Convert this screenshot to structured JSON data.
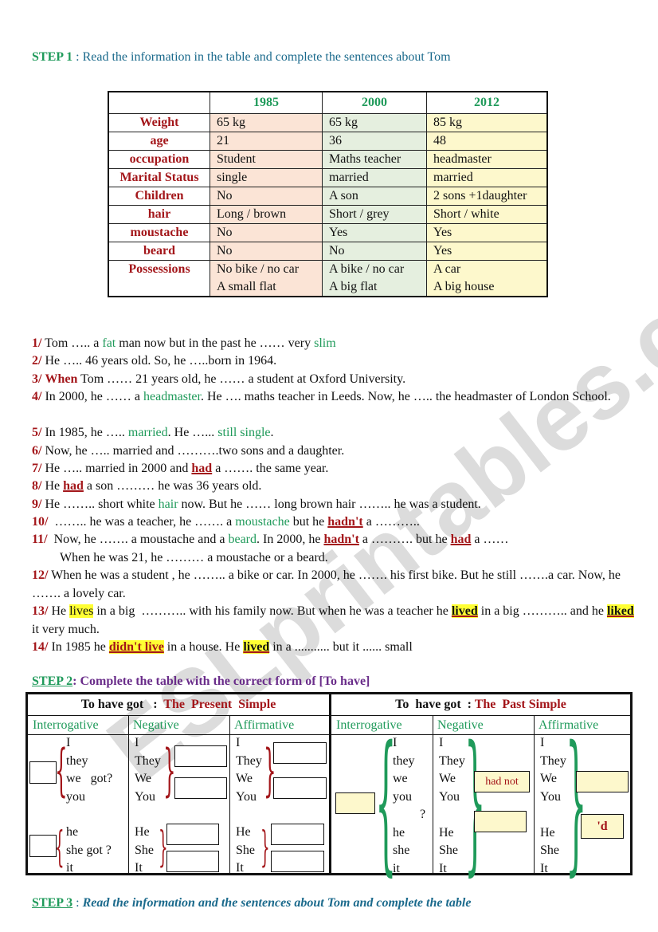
{
  "step1": {
    "label": "STEP 1",
    "separator": " : ",
    "text": "Read the information in the table and complete the sentences about Tom"
  },
  "info_table": {
    "years": [
      "1985",
      "2000",
      "2012"
    ],
    "rows": [
      {
        "label": "Weight",
        "values": [
          "65 kg",
          "65 kg",
          "85 kg"
        ]
      },
      {
        "label": "age",
        "values": [
          "21",
          "36",
          "48"
        ]
      },
      {
        "label": "occupation",
        "values": [
          "Student",
          "Maths teacher",
          "headmaster"
        ]
      },
      {
        "label": "Marital Status",
        "values": [
          "single",
          "married",
          "married"
        ]
      },
      {
        "label": "Children",
        "values": [
          "No",
          "A son",
          "2 sons +1daughter"
        ]
      },
      {
        "label": "hair",
        "values": [
          "Long / brown",
          "Short / grey",
          "Short / white"
        ]
      },
      {
        "label": "moustache",
        "values": [
          "No",
          "Yes",
          "Yes"
        ]
      },
      {
        "label": "beard",
        "values": [
          "No",
          "No",
          "Yes"
        ]
      },
      {
        "label": "Possessions",
        "values": [
          "No bike / no car",
          "A bike / no car",
          "A car"
        ],
        "values2": [
          "A small flat",
          "A big flat",
          "A big house"
        ]
      }
    ]
  },
  "sentences": [
    {
      "num": "1/",
      "parts": [
        {
          "t": " Tom ….. a "
        },
        {
          "t": "fat",
          "c": "g"
        },
        {
          "t": " man now but in the past he …… very "
        },
        {
          "t": "slim",
          "c": "g"
        }
      ]
    },
    {
      "num": "2/",
      "parts": [
        {
          "t": " He ….. 46 years old. So, he …..born in 1964."
        }
      ]
    },
    {
      "num": "3/",
      "parts": [
        {
          "t": " "
        },
        {
          "t": "When",
          "c": "r"
        },
        {
          "t": " Tom …… 21 years old, he …… a student at Oxford University."
        }
      ]
    },
    {
      "num": "4/",
      "parts": [
        {
          "t": " In 2000, he …… a "
        },
        {
          "t": "headmaster",
          "c": "g"
        },
        {
          "t": ". He …. maths teacher in Leeds. Now, he ….. the headmaster of London School."
        }
      ]
    },
    {
      "num": "5/",
      "parts": [
        {
          "t": " In 1985, he ….. "
        },
        {
          "t": "married",
          "c": "g"
        },
        {
          "t": ". He …... "
        },
        {
          "t": "still single",
          "c": "g"
        },
        {
          "t": "."
        }
      ]
    },
    {
      "num": "6/",
      "parts": [
        {
          "t": " Now, he ….. married and ……….two sons and a daughter."
        }
      ]
    },
    {
      "num": "7/",
      "parts": [
        {
          "t": " He ….. married in 2000 and "
        },
        {
          "t": "had",
          "c": "ru"
        },
        {
          "t": " a ……. the same year."
        }
      ]
    },
    {
      "num": "8/",
      "parts": [
        {
          "t": " He "
        },
        {
          "t": "had",
          "c": "ru"
        },
        {
          "t": " a son ……… he was 36 years old."
        }
      ]
    },
    {
      "num": "9/",
      "parts": [
        {
          "t": " He …….. short white "
        },
        {
          "t": "hair",
          "c": "g"
        },
        {
          "t": " now. But he …… long brown hair …….. he was a student."
        }
      ]
    },
    {
      "num": "10/",
      "parts": [
        {
          "t": "  …….. he was a teacher, he ……. a "
        },
        {
          "t": "moustache",
          "c": "g"
        },
        {
          "t": " but he "
        },
        {
          "t": "hadn't",
          "c": "ru"
        },
        {
          "t": " a ……….."
        }
      ]
    },
    {
      "num": "11/",
      "parts": [
        {
          "t": "  Now, he ……. a moustache and a "
        },
        {
          "t": "beard",
          "c": "g"
        },
        {
          "t": ". In 2000, he "
        },
        {
          "t": "hadn't",
          "c": "ru"
        },
        {
          "t": " a ………. but he "
        },
        {
          "t": "had",
          "c": "ru"
        },
        {
          "t": " a ……"
        }
      ],
      "cont": "When he was 21, he ……… a moustache or a beard."
    },
    {
      "num": "12/",
      "parts": [
        {
          "t": " When he was a student , he …….. a bike or car. In 2000, he ……. his first bike. But he still …….a car. Now, he ……. a lovely car."
        }
      ]
    },
    {
      "num": "13/",
      "parts": [
        {
          "t": " He "
        },
        {
          "t": "lives",
          "c": "h"
        },
        {
          "t": " in a big  ……….. with his family now. But when he was a teacher he "
        },
        {
          "t": "lived",
          "c": "hu"
        },
        {
          "t": " in a big ……….. and he "
        },
        {
          "t": "liked",
          "c": "hu"
        },
        {
          "t": " it very much."
        }
      ]
    },
    {
      "num": "14/",
      "parts": [
        {
          "t": " In 1985 he "
        },
        {
          "t": "didn't live",
          "c": "hur"
        },
        {
          "t": " in a house. He "
        },
        {
          "t": "lived",
          "c": "hu"
        },
        {
          "t": " in a ........... but it ...... small"
        }
      ]
    }
  ],
  "step2": {
    "label": "STEP 2",
    "text": ": Complete the table with the correct form of [To have]",
    "present": {
      "prefix": "To have got   :  ",
      "title": "The  Present  Simple"
    },
    "past": {
      "prefix": "To  have got  : ",
      "title": "The  Past Simple"
    },
    "columns": [
      "Interrogative",
      "Negative",
      "Affirmative"
    ],
    "present_interrogative": {
      "group1": [
        "I",
        "they",
        "we   got?",
        "you"
      ],
      "group2": [
        "he",
        "she got ?",
        "it"
      ]
    },
    "present_negative": {
      "group1": [
        "I",
        "They",
        "We",
        "You"
      ],
      "group2": [
        "He",
        "She",
        "It"
      ]
    },
    "present_affirmative": {
      "group1": [
        "I",
        "They",
        "We",
        "You"
      ],
      "group2": [
        "He",
        "She",
        "It"
      ]
    },
    "past_interrogative": {
      "pronouns": [
        "I",
        "they",
        "we",
        "you",
        "he",
        "she",
        "it"
      ],
      "qmark": "?"
    },
    "past_negative": {
      "pronouns": [
        "I",
        "They",
        "We",
        "You",
        "He",
        "She",
        "It"
      ],
      "box_value": "had not"
    },
    "past_affirmative": {
      "pronouns": [
        "I",
        "They",
        "We",
        "You",
        "He",
        "She",
        "It"
      ],
      "box_value": "'d"
    }
  },
  "step3": {
    "label": "STEP 3",
    "separator": " : ",
    "text": "Read the information and the sentences about Tom and complete the table"
  },
  "watermark": "ESLprintables.com"
}
